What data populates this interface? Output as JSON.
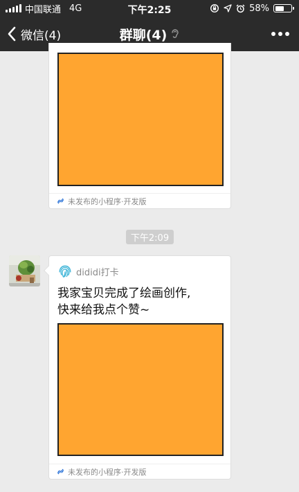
{
  "status_bar": {
    "carrier": "中国联通",
    "network": "4G",
    "time": "下午2:25",
    "battery": "58%",
    "battery_level": 0.58
  },
  "nav": {
    "back_label": "微信(4)",
    "title": "群聊(4)",
    "more_icon": "more-dots-icon"
  },
  "messages": [
    {
      "footer": "未发布的小程序·开发版"
    },
    {
      "timestamp": "下午2:09",
      "app_name": "dididi打卡",
      "text_line1": "我家宝贝完成了绘画创作,",
      "text_line2": "快来给我点个赞~",
      "footer": "未发布的小程序·开发版"
    }
  ],
  "colors": {
    "bar": "#2b2b2b",
    "background": "#ebebeb",
    "thumbnail": "#ffa530",
    "link": "#1f6bd6"
  }
}
